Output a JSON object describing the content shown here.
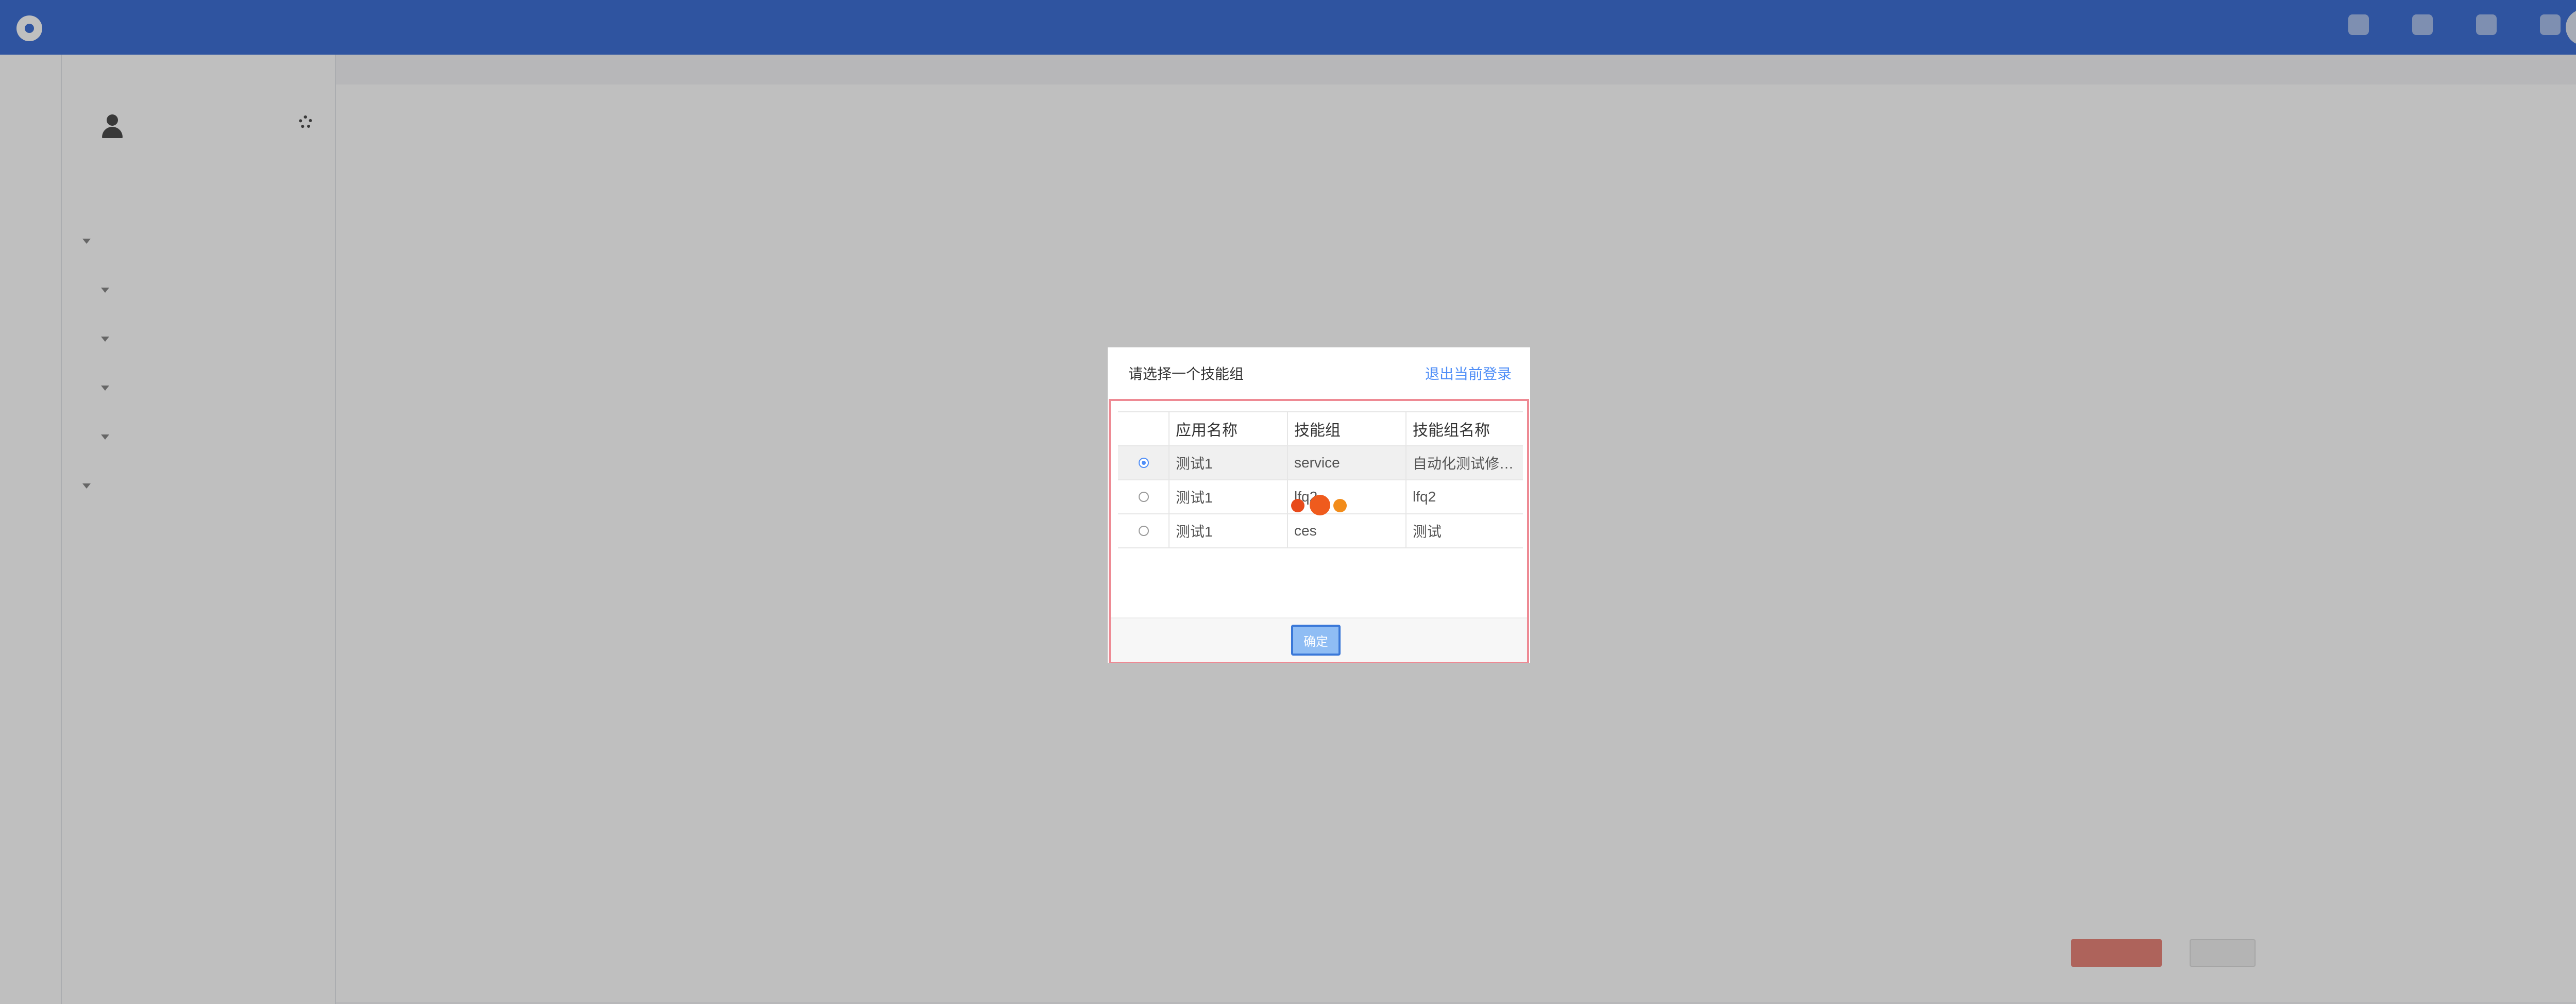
{
  "background": {
    "breadcrumb": "",
    "side_tabs": [
      "",
      ""
    ],
    "side_items": [
      {
        "label": "",
        "indent": "group"
      },
      {
        "label": "",
        "indent": "sub"
      },
      {
        "label": "",
        "indent": "sub"
      },
      {
        "label": "",
        "indent": "sub"
      },
      {
        "label": "",
        "indent": "sub"
      },
      {
        "label": "",
        "indent": "group"
      },
      {
        "label": "",
        "indent": "plain"
      },
      {
        "label": "",
        "indent": "plain"
      }
    ],
    "footer_text": ""
  },
  "modal": {
    "title": "请选择一个技能组",
    "logout_link": "退出当前登录",
    "columns": [
      "应用名称",
      "技能组",
      "技能组名称"
    ],
    "rows": [
      {
        "app": "测试1",
        "group": "service",
        "group_name": "自动化测试修…",
        "selected": true
      },
      {
        "app": "测试1",
        "group": "lfq2",
        "group_name": "lfq2",
        "selected": false
      },
      {
        "app": "测试1",
        "group": "ces",
        "group_name": "测试",
        "selected": false
      }
    ],
    "confirm_label": "确定"
  },
  "colors": {
    "brand": "#3f71d6",
    "link": "#4f8ef7",
    "error_border": "#ee8a94",
    "loader": [
      "#e84a1a",
      "#ef5b1d",
      "#f28c1a"
    ]
  },
  "icons": [
    "logo-icon",
    "person-icon",
    "gear-icon",
    "radio-icon",
    "loading-icon"
  ]
}
